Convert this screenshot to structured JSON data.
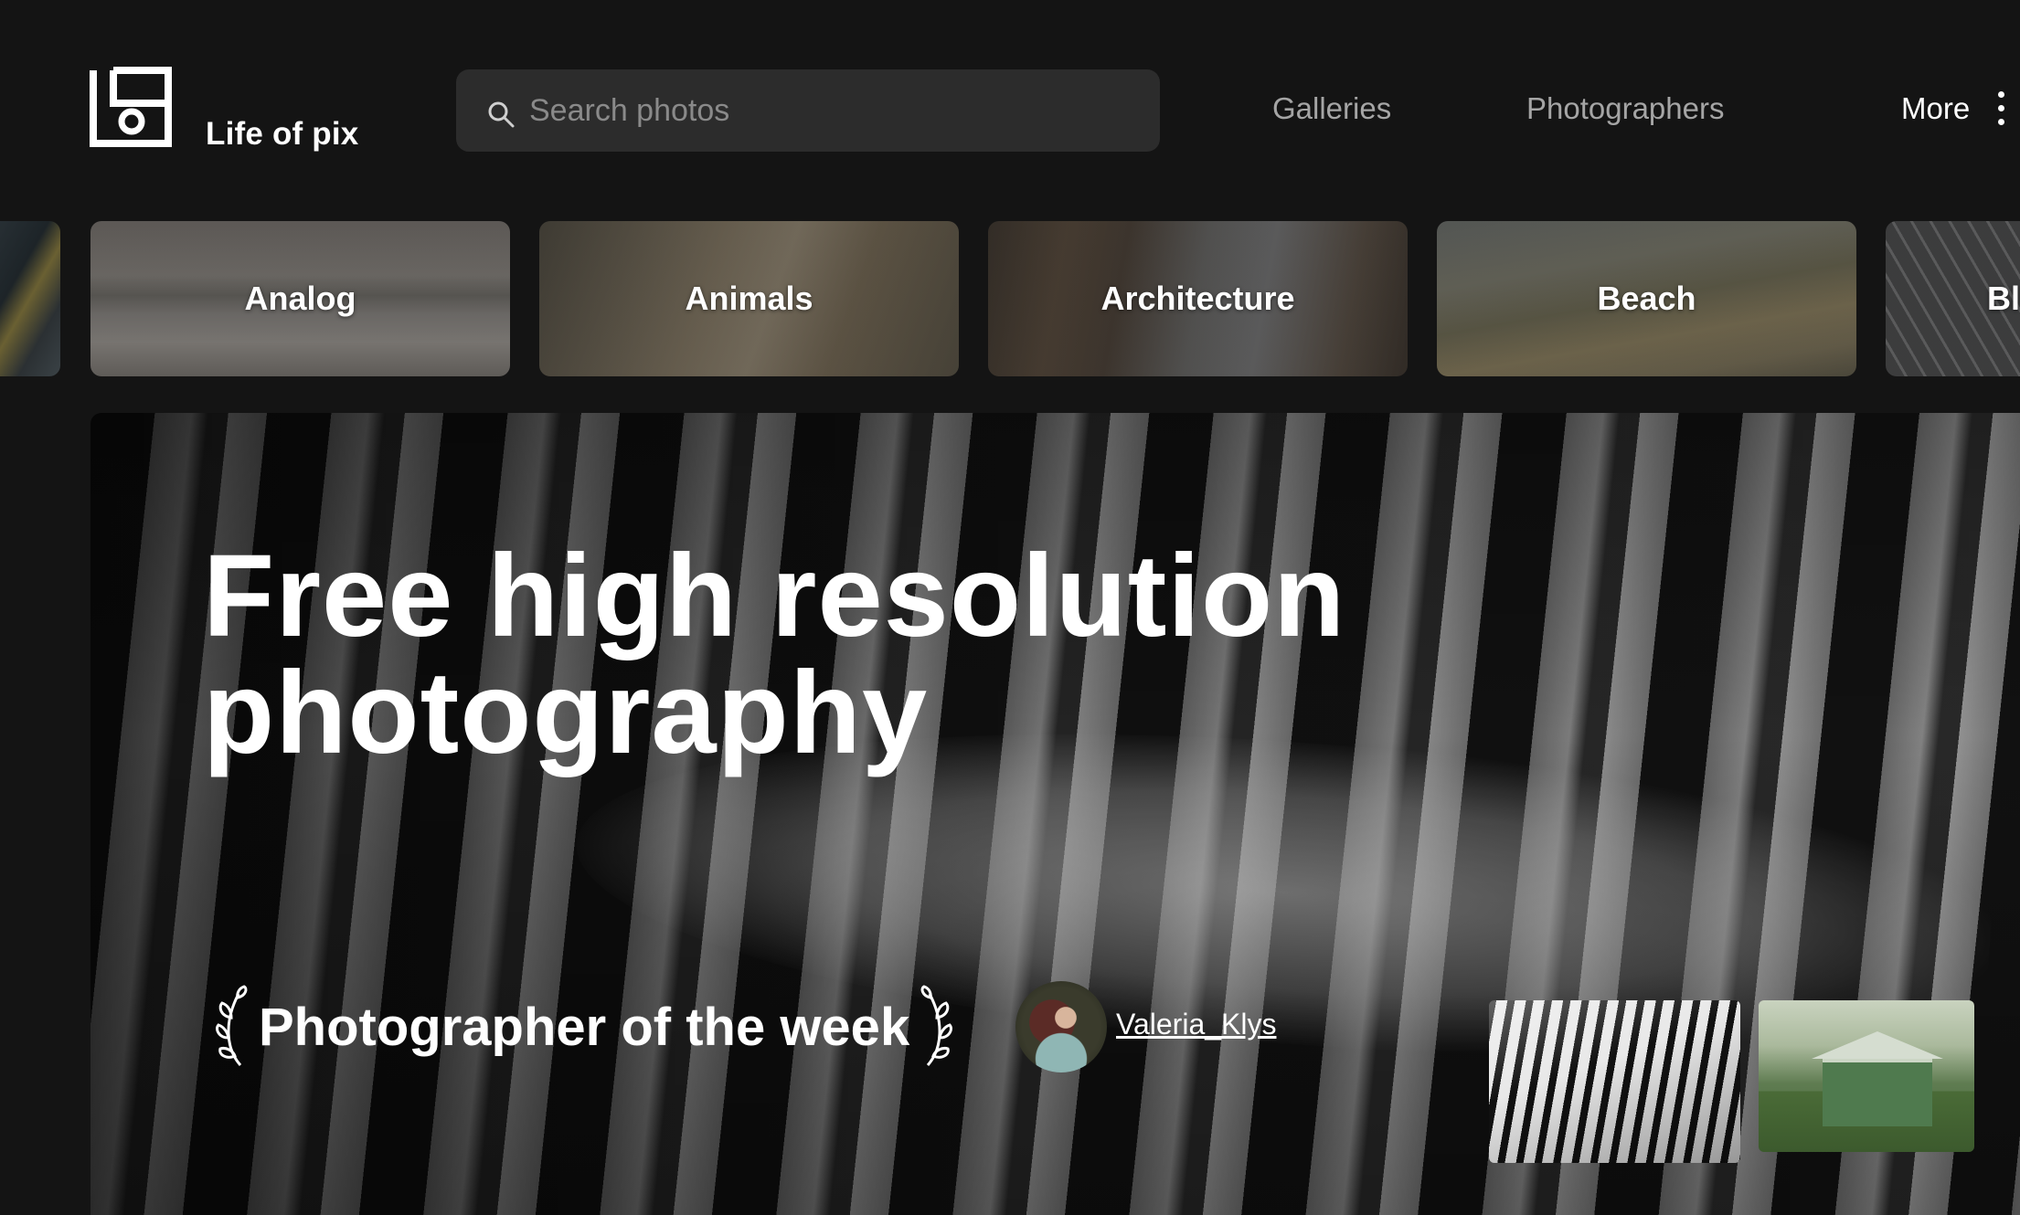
{
  "header": {
    "brand_name": "Life of pix",
    "search_placeholder": "Search photos",
    "nav": {
      "galleries": "Galleries",
      "photographers": "Photographers",
      "more": "More"
    }
  },
  "categories": [
    {
      "label": "Analog"
    },
    {
      "label": "Animals"
    },
    {
      "label": "Architecture"
    },
    {
      "label": "Beach"
    },
    {
      "label": "Bl"
    }
  ],
  "hero": {
    "title_line1": "Free high resolution",
    "title_line2": "photography",
    "photographer_of_week_label": "Photographer of the week",
    "photographer_name": "Valeria_Klys"
  },
  "colors": {
    "background": "#141414",
    "search_bg": "#2c2c2c",
    "nav_muted": "#a5a5a5",
    "text": "#ffffff"
  }
}
